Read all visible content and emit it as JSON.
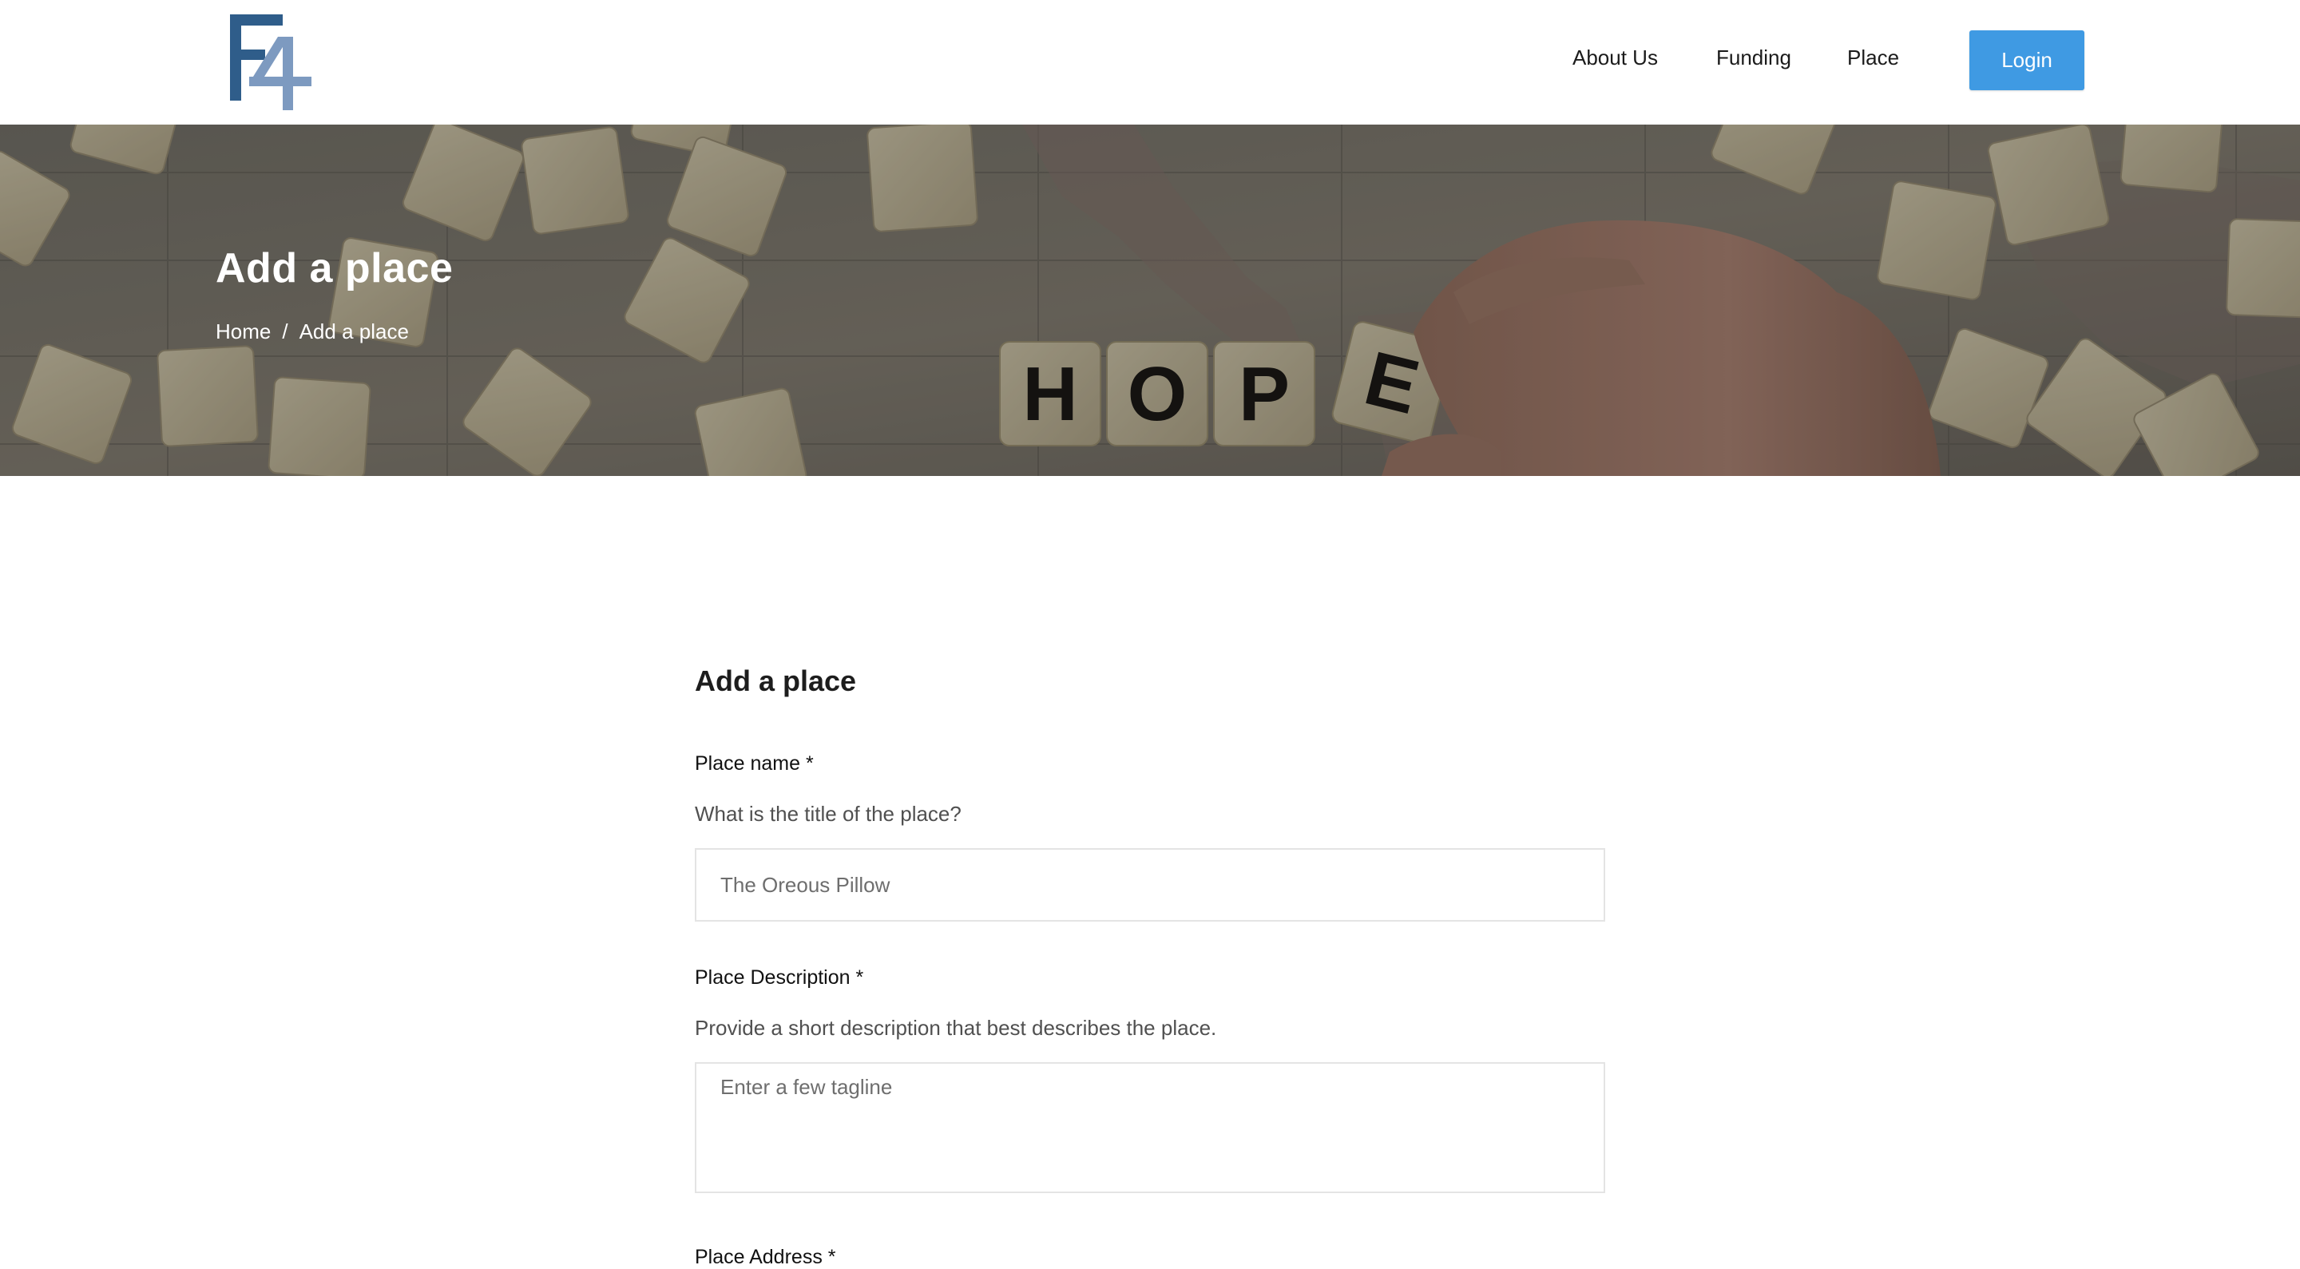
{
  "header": {
    "logo_text": "F4",
    "nav": {
      "about": "About Us",
      "funding": "Funding",
      "place": "Place"
    },
    "login_label": "Login",
    "colors": {
      "logo_dark": "#2f5d8a",
      "logo_light": "#7d9ac0",
      "login_bg": "#3f9ae3"
    }
  },
  "hero": {
    "title": "Add a place",
    "breadcrumb": {
      "home": "Home",
      "separator": "/",
      "current": "Add a place"
    },
    "tile_letters": [
      "H",
      "O",
      "P",
      "E"
    ]
  },
  "form": {
    "title": "Add a place",
    "place_name": {
      "label": "Place name *",
      "help": "What is the title of the place?",
      "placeholder": "The Oreous Pillow"
    },
    "place_description": {
      "label": "Place Description *",
      "help": "Provide a short description that best describes the place.",
      "placeholder": "Enter a few tagline"
    },
    "place_address": {
      "label": "Place Address *"
    }
  }
}
